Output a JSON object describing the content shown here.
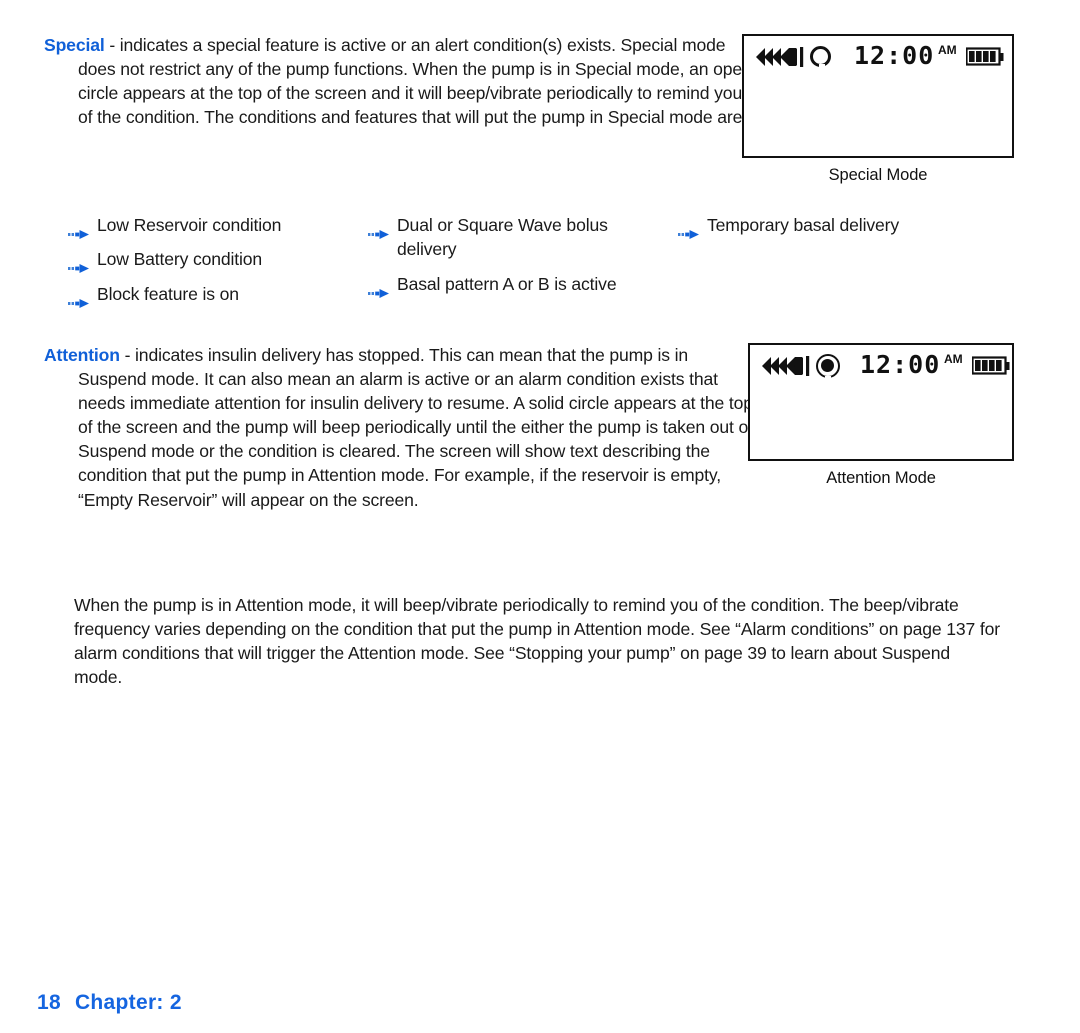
{
  "page": {
    "footer_page_number": "18",
    "footer_chapter": "Chapter: 2",
    "accent_color": "#1060d8",
    "text_color": "#1a1a1a"
  },
  "special_section": {
    "keyword": "Special",
    "body": " - indicates a special feature is active or an alert condition(s) exists. Special mode does not restrict any of the pump functions. When the pump is in Special mode, an open circle appears at the top of the screen and it will beep/vibrate periodically to remind you of the condition. The conditions and features that will put the pump in Special mode are:",
    "bullets_column_1": [
      "Low Reservoir condition",
      "Low Battery condition",
      "Block feature is on"
    ],
    "bullets_column_2": [
      "Dual or Square Wave bolus delivery",
      "Basal pattern A or B is active"
    ],
    "bullets_column_3": [
      "Temporary basal delivery"
    ]
  },
  "attention_section": {
    "keyword": "Attention",
    "body": " - indicates insulin delivery has stopped. This can mean that the pump is in Suspend mode. It can also mean an alarm is active or an alarm condition exists that needs immediate attention for insulin delivery to resume. A solid circle appears at the top of the screen and the pump will beep periodically until the either the pump is taken out of Suspend mode or the condition is cleared. The screen will show text describing the condition that put the pump in Attention mode. For example, if the reservoir is empty, “Empty Reservoir” will appear on the screen."
  },
  "closing_paragraph": {
    "body": "When the pump is in Attention mode, it will beep/vibrate periodically to remind you of the condition. The beep/vibrate frequency varies depending on the condition that put the pump in Attention mode. See “Alarm conditions” on page 137 for alarm conditions that will trigger the Attention mode. See “Stopping your pump” on page 39 to learn about Suspend mode."
  },
  "figures": [
    {
      "caption": "Special Mode",
      "status_icon": "chevron-flow-icon",
      "mode_indicator": "open-circle-icon",
      "time": "12:00",
      "meridiem": "AM",
      "battery": "battery-full-icon",
      "battery_bars": 4
    },
    {
      "caption": "Attention Mode",
      "status_icon": "chevron-flow-icon",
      "mode_indicator": "solid-circle-icon",
      "time": "12:00",
      "meridiem": "AM",
      "battery": "battery-full-icon",
      "battery_bars": 4
    }
  ]
}
